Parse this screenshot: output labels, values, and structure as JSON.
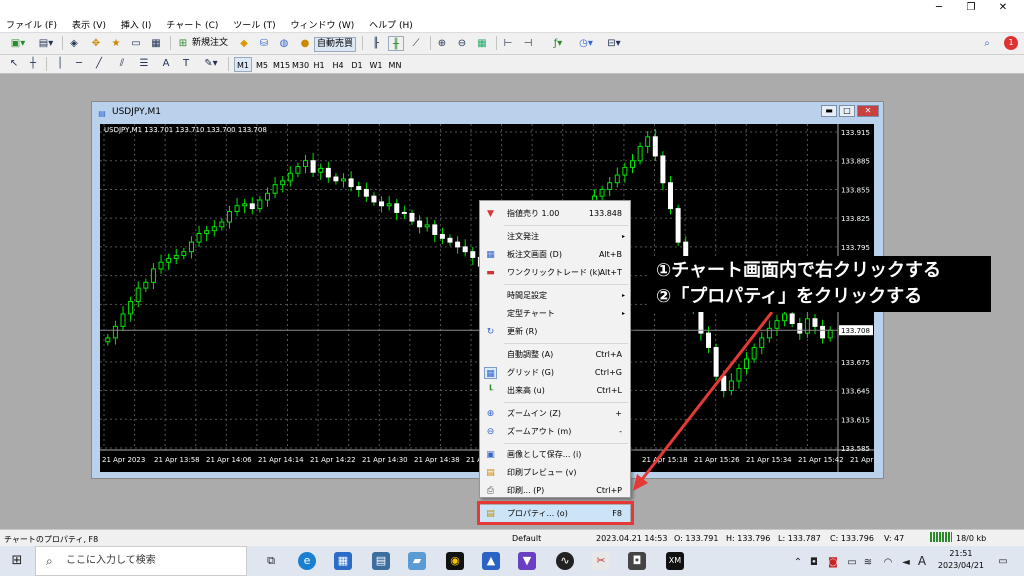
{
  "menubar": [
    "ファイル (F)",
    "表示 (V)",
    "挿入 (I)",
    "チャート (C)",
    "ツール (T)",
    "ウィンドウ (W)",
    "ヘルプ (H)"
  ],
  "toolbar": {
    "new_order": "新規注文",
    "auto_trade": "自動売買",
    "notify_count": "1"
  },
  "timeframes": [
    "M1",
    "M5",
    "M15",
    "M30",
    "H1",
    "H4",
    "D1",
    "W1",
    "MN"
  ],
  "chart_window": {
    "title": "USDJPY,M1"
  },
  "chart_data": {
    "type": "candlestick",
    "symbol_line": "USDJPY,M1  133.701 133.710 133.700 133.708",
    "y_ticks": [
      "133.915",
      "133.885",
      "133.855",
      "133.825",
      "133.795",
      "133.765",
      "133.735",
      "133.708",
      "133.675",
      "133.645",
      "133.615",
      "133.585"
    ],
    "x_ticks": [
      "21 Apr 2023",
      "21 Apr 13:58",
      "21 Apr 14:06",
      "21 Apr 14:14",
      "21 Apr 14:22",
      "21 Apr 14:30",
      "21 Apr 14:38",
      "21 Apr 14:46",
      "21 Apr 15:18",
      "21 Apr 15:26",
      "21 Apr 15:34",
      "21 Apr 15:42",
      "21 Apr 15:50"
    ],
    "current_price": "133.708",
    "ylim": [
      133.585,
      133.915
    ],
    "closes": [
      133.7,
      133.712,
      133.725,
      133.738,
      133.752,
      133.758,
      133.772,
      133.779,
      133.783,
      133.786,
      133.79,
      133.8,
      133.809,
      133.812,
      133.816,
      133.821,
      133.832,
      133.838,
      133.84,
      133.835,
      133.844,
      133.851,
      133.86,
      133.864,
      133.872,
      133.879,
      133.885,
      133.873,
      133.877,
      133.868,
      133.864,
      133.866,
      133.858,
      133.855,
      133.848,
      133.842,
      133.838,
      133.84,
      133.831,
      133.83,
      133.822,
      133.816,
      133.818,
      133.808,
      133.804,
      133.8,
      133.795,
      133.79,
      133.784,
      133.775,
      133.772,
      133.768,
      133.764,
      133.768,
      133.771,
      133.773,
      133.78,
      133.79,
      133.8,
      133.81,
      133.818,
      133.824,
      133.83,
      133.838,
      133.848,
      133.855,
      133.862,
      133.87,
      133.878,
      133.885,
      133.9,
      133.91,
      133.89,
      133.862,
      133.835,
      133.8,
      133.765,
      133.73,
      133.705,
      133.69,
      133.66,
      133.645,
      133.655,
      133.668,
      133.678,
      133.69,
      133.7,
      133.71,
      133.718,
      133.725,
      133.715,
      133.705,
      133.72,
      133.712,
      133.7,
      133.708
    ]
  },
  "context_menu": [
    {
      "icon": "sell-icon",
      "label": "指値売り 1.00",
      "shortcut": "133.848",
      "arrow": ""
    },
    {
      "sep": true
    },
    {
      "icon": "",
      "label": "注文発注",
      "shortcut": "",
      "arrow": "▸"
    },
    {
      "icon": "order-board-icon",
      "label": "板注文画面 (D)",
      "shortcut": "Alt+B",
      "arrow": ""
    },
    {
      "icon": "one-click-icon",
      "label": "ワンクリックトレード (k)",
      "shortcut": "Alt+T",
      "arrow": ""
    },
    {
      "sep": true
    },
    {
      "icon": "",
      "label": "時間足設定",
      "shortcut": "",
      "arrow": "▸"
    },
    {
      "icon": "",
      "label": "定型チャート",
      "shortcut": "",
      "arrow": "▸"
    },
    {
      "icon": "refresh-icon",
      "label": "更新 (R)",
      "shortcut": "",
      "arrow": ""
    },
    {
      "sep": true
    },
    {
      "icon": "",
      "label": "自動調整 (A)",
      "shortcut": "Ctrl+A",
      "arrow": ""
    },
    {
      "icon": "grid-icon",
      "label": "グリッド (G)",
      "shortcut": "Ctrl+G",
      "arrow": ""
    },
    {
      "icon": "volume-icon",
      "label": "出来高 (u)",
      "shortcut": "Ctrl+L",
      "arrow": ""
    },
    {
      "sep": true
    },
    {
      "icon": "zoom-in-icon",
      "label": "ズームイン (Z)",
      "shortcut": "+",
      "arrow": ""
    },
    {
      "icon": "zoom-out-icon",
      "label": "ズームアウト (m)",
      "shortcut": "-",
      "arrow": ""
    },
    {
      "sep": true
    },
    {
      "icon": "save-image-icon",
      "label": "画像として保存... (i)",
      "shortcut": "",
      "arrow": ""
    },
    {
      "icon": "print-preview-icon",
      "label": "印刷プレビュー (v)",
      "shortcut": "",
      "arrow": ""
    },
    {
      "icon": "print-icon",
      "label": "印刷... (P)",
      "shortcut": "Ctrl+P",
      "arrow": ""
    },
    {
      "sep": true
    },
    {
      "icon": "properties-icon",
      "label": "プロパティ... (o)",
      "shortcut": "F8",
      "arrow": "",
      "highlight": true
    }
  ],
  "annotation": {
    "line1": "①チャート画面内で右クリックする",
    "line2": "②「プロパティ」をクリックする"
  },
  "statusbar": {
    "hint": "チャートのプロパティ, F8",
    "profile": "Default",
    "datetime": "2023.04.21 14:53",
    "open": "O: 133.791",
    "high": "H: 133.796",
    "low": "L: 133.787",
    "close": "C: 133.796",
    "volume": "V: 47",
    "traffic": "18/0 kb"
  },
  "taskbar": {
    "search_placeholder": "ここに入力して検索",
    "time": "21:51",
    "date": "2023/04/21",
    "ime": "A"
  }
}
